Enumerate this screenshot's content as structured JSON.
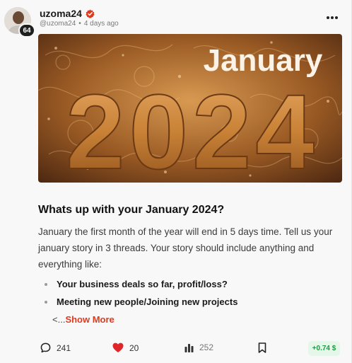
{
  "author": {
    "display_name": "uzoma24",
    "handle": "@uzoma24",
    "separator": "•",
    "posted_ago": "4 days ago",
    "level": "64"
  },
  "hero": {
    "heading_text": "January",
    "year_text": "2024"
  },
  "post": {
    "title": "Whats up with your January 2024?",
    "body": "January the first month of the year will end in 5 days time. Tell us your january story in 3 threads. Your story should include anything and everything like:",
    "bullets": [
      "Your business deals so far, profit/loss?",
      "Meeting new people/Joining new projects"
    ],
    "truncation_prefix": "<...",
    "show_more_label": "Show More"
  },
  "actions": {
    "comments_count": "241",
    "likes_count": "20",
    "views_count": "252",
    "earnings_label": "+0.74 $"
  },
  "colors": {
    "accent": "#e03a1e",
    "like": "#e0262b",
    "earnings_bg": "#e4f7e8",
    "earnings_text": "#1e9b43"
  }
}
